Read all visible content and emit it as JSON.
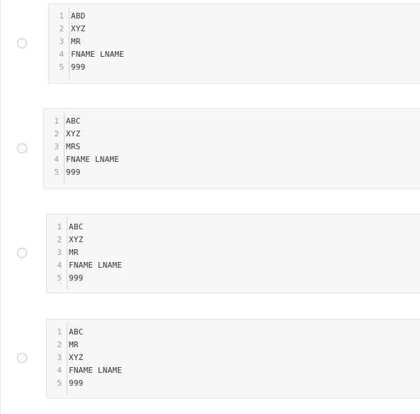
{
  "options": [
    {
      "lines": [
        {
          "num": "1",
          "text": "ABD"
        },
        {
          "num": "2",
          "text": "XYZ"
        },
        {
          "num": "3",
          "text": "MR"
        },
        {
          "num": "4",
          "text": "FNAME LNAME"
        },
        {
          "num": "5",
          "text": "999"
        }
      ]
    },
    {
      "lines": [
        {
          "num": "1",
          "text": "ABC"
        },
        {
          "num": "2",
          "text": "XYZ"
        },
        {
          "num": "3",
          "text": "MRS"
        },
        {
          "num": "4",
          "text": "FNAME LNAME"
        },
        {
          "num": "5",
          "text": "999"
        }
      ]
    },
    {
      "lines": [
        {
          "num": "1",
          "text": "ABC"
        },
        {
          "num": "2",
          "text": "XYZ"
        },
        {
          "num": "3",
          "text": "MR"
        },
        {
          "num": "4",
          "text": "FNAME LNAME"
        },
        {
          "num": "5",
          "text": "999"
        }
      ]
    },
    {
      "lines": [
        {
          "num": "1",
          "text": "ABC"
        },
        {
          "num": "2",
          "text": "MR"
        },
        {
          "num": "3",
          "text": "XYZ"
        },
        {
          "num": "4",
          "text": "FNAME LNAME"
        },
        {
          "num": "5",
          "text": "999"
        }
      ]
    }
  ]
}
